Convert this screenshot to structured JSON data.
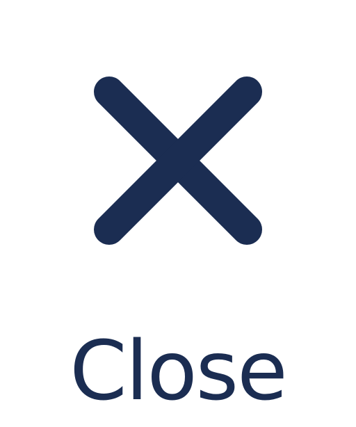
{
  "button": {
    "label": "Close",
    "icon": "close-icon",
    "color": "#1b2d52",
    "background": "#ffffff"
  }
}
